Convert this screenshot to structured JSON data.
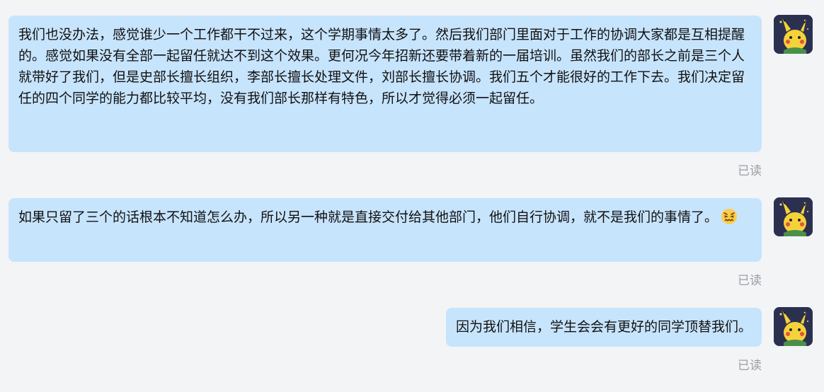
{
  "messages": [
    {
      "text": "我们也没办法，感觉谁少一个工作都干不过来，这个学期事情太多了。然后我们部门里面对于工作的协调大家都是互相提醒的。感觉如果没有全部一起留任就达不到这个效果。更何况今年招新还要带着新的一届培训。虽然我们的部长之前是三个人就带好了我们，但是史部长擅长组织，李部长擅长处理文件，刘部长擅长协调。我们五个才能很好的工作下去。我们决定留任的四个同学的能力都比较平均，没有我们部长那样有特色，所以才觉得必须一起留任。",
      "status": "已读"
    },
    {
      "text": "如果只留了三个的话根本不知道怎么办，所以另一种就是直接交付给其他部门，他们自行协调，就不是我们的事情了。",
      "emoji": "confounded-face-icon",
      "status": "已读"
    },
    {
      "text": "因为我们相信，学生会会有更好的同学顶替我们。",
      "status": "已读"
    }
  ],
  "avatar_icon": "pikachu-avatar-icon",
  "colors": {
    "background": "#f3f4f6",
    "bubble": "#c7e4fd",
    "text": "#111111",
    "status": "#9aa0a6"
  }
}
